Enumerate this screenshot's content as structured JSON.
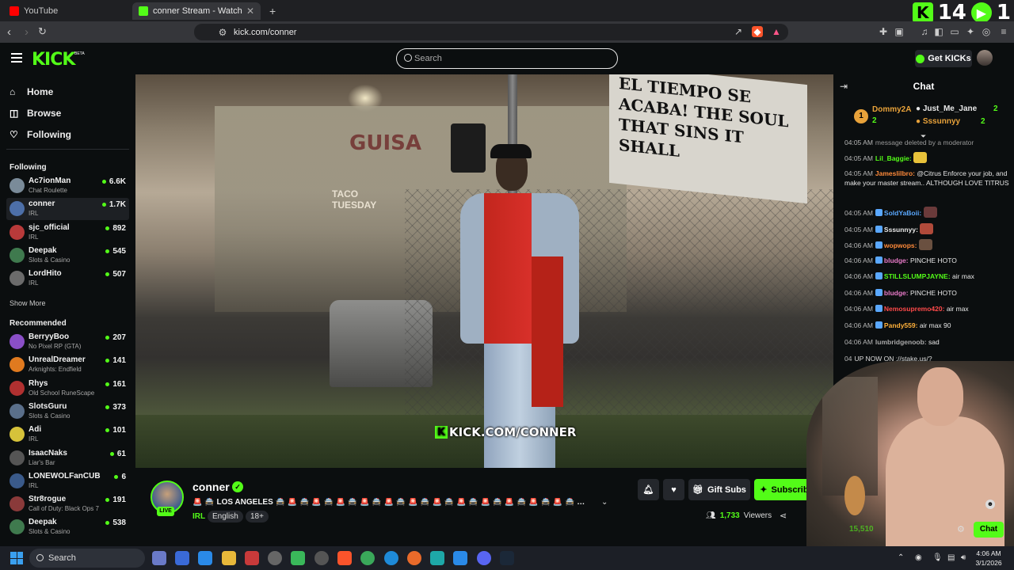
{
  "browser": {
    "tabs": [
      {
        "title": "YouTube",
        "active": false
      },
      {
        "title": "conner Stream - Watch Live o",
        "active": true
      }
    ],
    "new_tab": "+",
    "url": "kick.com/conner",
    "overlay_counter": {
      "left_value": "14",
      "right_value": "1"
    }
  },
  "header": {
    "logo": "KICK",
    "beta": "BETA",
    "search_placeholder": "Search",
    "get_kicks_label": "Get KICKs"
  },
  "sidebar": {
    "nav": [
      {
        "label": "Home",
        "icon": "home-icon"
      },
      {
        "label": "Browse",
        "icon": "browse-icon"
      },
      {
        "label": "Following",
        "icon": "heart-icon"
      }
    ],
    "following_heading": "Following",
    "following": [
      {
        "name": "Ac7ionMan",
        "category": "Chat Roulette",
        "viewers": "6.6K",
        "color": "#7a8b99"
      },
      {
        "name": "conner",
        "category": "IRL",
        "viewers": "1.7K",
        "color": "#4d6fa8"
      },
      {
        "name": "sjc_official",
        "category": "IRL",
        "viewers": "892",
        "color": "#b83a3a"
      },
      {
        "name": "Deepak",
        "category": "Slots & Casino",
        "viewers": "545",
        "color": "#3f7a4e"
      },
      {
        "name": "LordHito",
        "category": "IRL",
        "viewers": "507",
        "color": "#6b6b6b"
      }
    ],
    "show_more": "Show More",
    "recommended_heading": "Recommended",
    "recommended": [
      {
        "name": "BerryyBoo",
        "category": "No Pixel RP (GTA)",
        "viewers": "207",
        "color": "#8a4fc7"
      },
      {
        "name": "UnrealDreamer",
        "category": "Arknights: Endfield",
        "viewers": "141",
        "color": "#e07a1f"
      },
      {
        "name": "Rhys",
        "category": "Old School RuneScape",
        "viewers": "161",
        "color": "#b03030"
      },
      {
        "name": "SlotsGuru",
        "category": "Slots & Casino",
        "viewers": "373",
        "color": "#5a6f8a"
      },
      {
        "name": "Adi",
        "category": "IRL",
        "viewers": "101",
        "color": "#d6c23a"
      },
      {
        "name": "IsaacNaks",
        "category": "Liar's Bar",
        "viewers": "61",
        "color": "#555555"
      },
      {
        "name": "LONEWOLFanCUB",
        "category": "IRL",
        "viewers": "6",
        "color": "#3a5a8a"
      },
      {
        "name": "Str8rogue",
        "category": "Call of Duty: Black Ops 7",
        "viewers": "191",
        "color": "#8a3a3a"
      },
      {
        "name": "Deepak",
        "category": "Slots & Casino",
        "viewers": "538",
        "color": "#3f7a4e"
      }
    ]
  },
  "video": {
    "sign_text": "EL TIEMPO SE ACABA! THE SOUL THAT SINS IT SHALL",
    "store_text": "GUISA",
    "taco_text": "TACO TUESDAY",
    "watermark": "KICK.COM/CONNER"
  },
  "stream": {
    "streamer": "conner",
    "live_label": "LIVE",
    "title": "🚨 🚔 LOS ANGELES 🚔 🚨 🚔 🚨 🚔 🚨 🚔 🚨 🚔 🚨 🚔 🚨 🚔 🚨 🚔 🚨 🚔 🚨 🚔 🚨 🚔 🚨 🚔 🚨 🚔 🚨 🚔 ...",
    "category": "IRL",
    "tags": [
      "English",
      "18+"
    ],
    "gift_subs_label": "Gift Subs",
    "subscribe_label": "Subscribe",
    "viewers_count": "1,733",
    "viewers_label": "Viewers"
  },
  "chat": {
    "title": "Chat",
    "top_gifters": [
      {
        "rank": "1",
        "name": "Dommy2A",
        "count": "2",
        "color": "#e8a23a"
      },
      {
        "name": "Just_Me_Jane",
        "count": "2",
        "color": "#e8e8e8"
      },
      {
        "name": "Sssunnyy",
        "count": "2",
        "color": "#e8a23a"
      }
    ],
    "messages": [
      {
        "time": "04:05 AM",
        "user": "",
        "text": "message deleted by a moderator",
        "color": "#999999"
      },
      {
        "time": "04:05 AM",
        "user": "Lil_Baggie:",
        "text": "",
        "color": "#53fc18",
        "emote": "#e8c23a"
      },
      {
        "time": "04:05 AM",
        "user": "Jameslilbro:",
        "text": " @Citrus Enforce your job, and make your master stream.. ALTHOUGH LOVE TITRUS",
        "color": "#ff8a3a"
      },
      {
        "time": "04:05 AM",
        "user": "SoldYaBoii:",
        "text": "",
        "color": "#5aa8ff",
        "emote": "#6a3a3a"
      },
      {
        "time": "04:05 AM",
        "user": "Sssunnyy:",
        "text": "",
        "color": "#e8e8e8",
        "emote": "#b04a3a"
      },
      {
        "time": "04:06 AM",
        "user": "wopwops:",
        "text": "",
        "color": "#ff8a3a",
        "emote": "#6a5040"
      },
      {
        "time": "04:06 AM",
        "user": "bludge:",
        "text": " PINCHE HOTO",
        "color": "#e87ac8"
      },
      {
        "time": "04:06 AM",
        "user": "STILLSLUMPJAYNE:",
        "text": " air max",
        "color": "#53fc18"
      },
      {
        "time": "04:06 AM",
        "user": "bludge:",
        "text": " PINCHE HOTO",
        "color": "#e87ac8"
      },
      {
        "time": "04:06 AM",
        "user": "Nemosupremo420:",
        "text": " air max",
        "color": "#ff4a4a"
      },
      {
        "time": "04:06 AM",
        "user": "Pandy559:",
        "text": " air max 90",
        "color": "#ffb03a"
      },
      {
        "time": "04:06 AM",
        "user": "lumbridgenoob:",
        "text": " sad",
        "color": "#aaaaaa"
      },
      {
        "time": "04",
        "user": "",
        "text": "UP NOW ON ://stake.us/?",
        "color": "#dddddd"
      }
    ],
    "points": "15,510",
    "send_label": "Chat"
  },
  "taskbar": {
    "search_label": "Search",
    "time": "4:06 AM",
    "date": "3/1/2026"
  },
  "colors": {
    "accent": "#53fc18",
    "bg": "#0b0e0f",
    "panel": "#24272c"
  }
}
